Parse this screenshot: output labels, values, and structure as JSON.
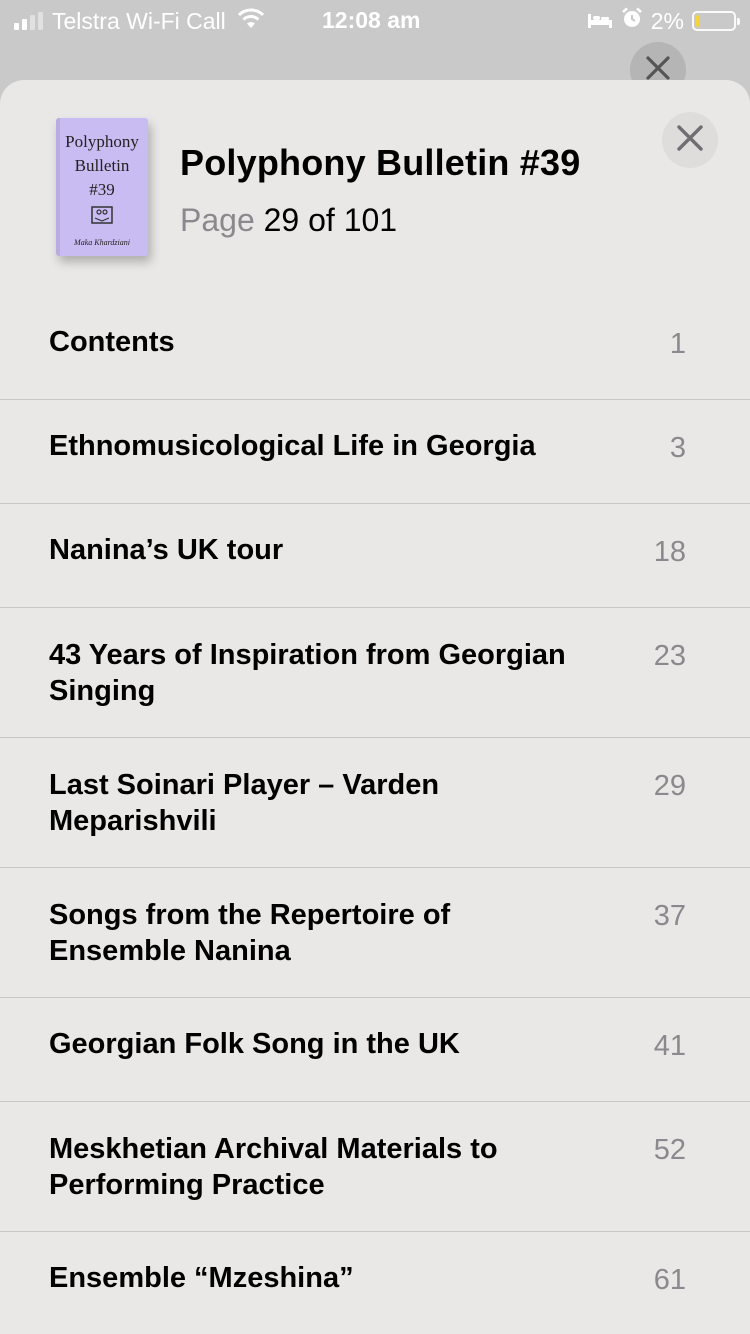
{
  "status_bar": {
    "carrier": "Telstra Wi-Fi Call",
    "time": "12:08 am",
    "battery_percent": "2%",
    "battery_level": 0.05,
    "battery_color": "#f5d33a",
    "icons": [
      "signal-icon",
      "wifi-icon",
      "sleep-icon",
      "alarm-icon",
      "battery-icon"
    ]
  },
  "book": {
    "cover": {
      "title_line1": "Polyphony",
      "title_line2": "Bulletin",
      "number": "#39",
      "author": "Maka Khardziani",
      "color": "#c9bcf2"
    },
    "title": "Polyphony Bulletin #39",
    "page_label": "Page",
    "page_value": "29 of 101"
  },
  "toc": [
    {
      "title": "Contents",
      "page": "1"
    },
    {
      "title": "Ethnomusicological Life in Georgia",
      "page": "3"
    },
    {
      "title": "Nanina’s UK tour",
      "page": "18"
    },
    {
      "title": "43 Years of Inspiration from Georgian Singing",
      "page": "23"
    },
    {
      "title": "Last Soinari Player – Varden Meparishvili",
      "page": "29"
    },
    {
      "title": "Songs from the Repertoire of Ensemble Nanina",
      "page": "37"
    },
    {
      "title": "Georgian Folk Song in the UK",
      "page": "41"
    },
    {
      "title": "Meskhetian Archival Materials to Performing Practice",
      "page": "52"
    },
    {
      "title": "Ensemble “Mzeshina”",
      "page": "61"
    }
  ]
}
